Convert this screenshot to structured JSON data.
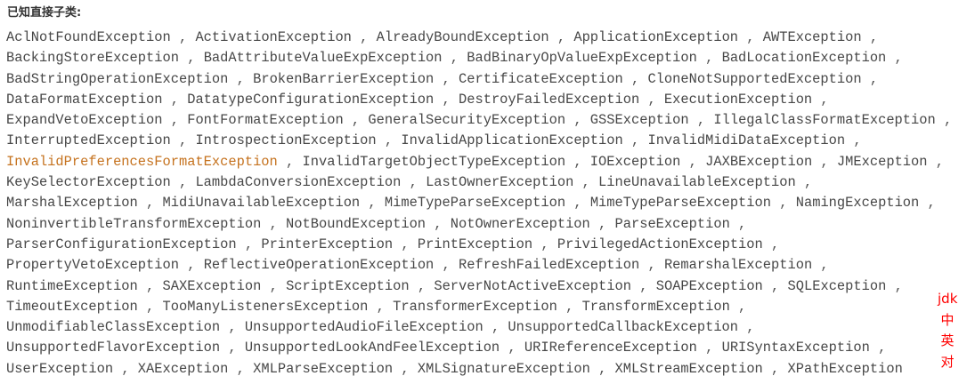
{
  "heading": "已知直接子类:",
  "rows": [
    [
      {
        "t": "AclNotFoundException"
      },
      {
        "t": "ActivationException"
      },
      {
        "t": "AlreadyBoundException"
      },
      {
        "t": "ApplicationException"
      },
      {
        "t": "AWTException"
      }
    ],
    [
      {
        "t": "BackingStoreException"
      },
      {
        "t": "BadAttributeValueExpException"
      },
      {
        "t": "BadBinaryOpValueExpException"
      },
      {
        "t": "BadLocationException"
      }
    ],
    [
      {
        "t": "BadStringOperationException"
      },
      {
        "t": "BrokenBarrierException"
      },
      {
        "t": "CertificateException"
      },
      {
        "t": "CloneNotSupportedException"
      }
    ],
    [
      {
        "t": "DataFormatException"
      },
      {
        "t": "DatatypeConfigurationException"
      },
      {
        "t": "DestroyFailedException"
      },
      {
        "t": "ExecutionException"
      }
    ],
    [
      {
        "t": "ExpandVetoException"
      },
      {
        "t": "FontFormatException"
      },
      {
        "t": "GeneralSecurityException"
      },
      {
        "t": "GSSException"
      },
      {
        "t": "IllegalClassFormatException"
      }
    ],
    [
      {
        "t": "InterruptedException"
      },
      {
        "t": "IntrospectionException"
      },
      {
        "t": "InvalidApplicationException"
      },
      {
        "t": "InvalidMidiDataException"
      }
    ],
    [
      {
        "t": "InvalidPreferencesFormatException",
        "visited": true
      },
      {
        "t": "InvalidTargetObjectTypeException"
      },
      {
        "t": "IOException"
      },
      {
        "t": "JAXBException"
      },
      {
        "t": "JMException"
      }
    ],
    [
      {
        "t": "KeySelectorException"
      },
      {
        "t": "LambdaConversionException"
      },
      {
        "t": "LastOwnerException"
      },
      {
        "t": "LineUnavailableException"
      }
    ],
    [
      {
        "t": "MarshalException"
      },
      {
        "t": "MidiUnavailableException"
      },
      {
        "t": "MimeTypeParseException"
      },
      {
        "t": "MimeTypeParseException"
      },
      {
        "t": "NamingException"
      }
    ],
    [
      {
        "t": "NoninvertibleTransformException"
      },
      {
        "t": "NotBoundException"
      },
      {
        "t": "NotOwnerException"
      },
      {
        "t": "ParseException"
      }
    ],
    [
      {
        "t": "ParserConfigurationException"
      },
      {
        "t": "PrinterException"
      },
      {
        "t": "PrintException"
      },
      {
        "t": "PrivilegedActionException"
      }
    ],
    [
      {
        "t": "PropertyVetoException"
      },
      {
        "t": "ReflectiveOperationException"
      },
      {
        "t": "RefreshFailedException"
      },
      {
        "t": "RemarshalException"
      }
    ],
    [
      {
        "t": "RuntimeException"
      },
      {
        "t": "SAXException"
      },
      {
        "t": "ScriptException"
      },
      {
        "t": "ServerNotActiveException"
      },
      {
        "t": "SOAPException"
      },
      {
        "t": "SQLException"
      }
    ],
    [
      {
        "t": "TimeoutException"
      },
      {
        "t": "TooManyListenersException"
      },
      {
        "t": "TransformerException"
      },
      {
        "t": "TransformException"
      }
    ],
    [
      {
        "t": "UnmodifiableClassException"
      },
      {
        "t": "UnsupportedAudioFileException"
      },
      {
        "t": "UnsupportedCallbackException"
      }
    ],
    [
      {
        "t": "UnsupportedFlavorException"
      },
      {
        "t": "UnsupportedLookAndFeelException"
      },
      {
        "t": "URIReferenceException"
      },
      {
        "t": "URISyntaxException"
      }
    ],
    [
      {
        "t": "UserException"
      },
      {
        "t": "XAException"
      },
      {
        "t": "XMLParseException"
      },
      {
        "t": "XMLSignatureException"
      },
      {
        "t": "XMLStreamException"
      },
      {
        "t": "XPathException",
        "last": true
      }
    ]
  ],
  "separator": " , ",
  "annotation": [
    "jdk",
    "中",
    "英",
    "对"
  ],
  "colors": {
    "link": "#474747",
    "visited_link": "#c5721e",
    "annotation": "#ff0000"
  }
}
